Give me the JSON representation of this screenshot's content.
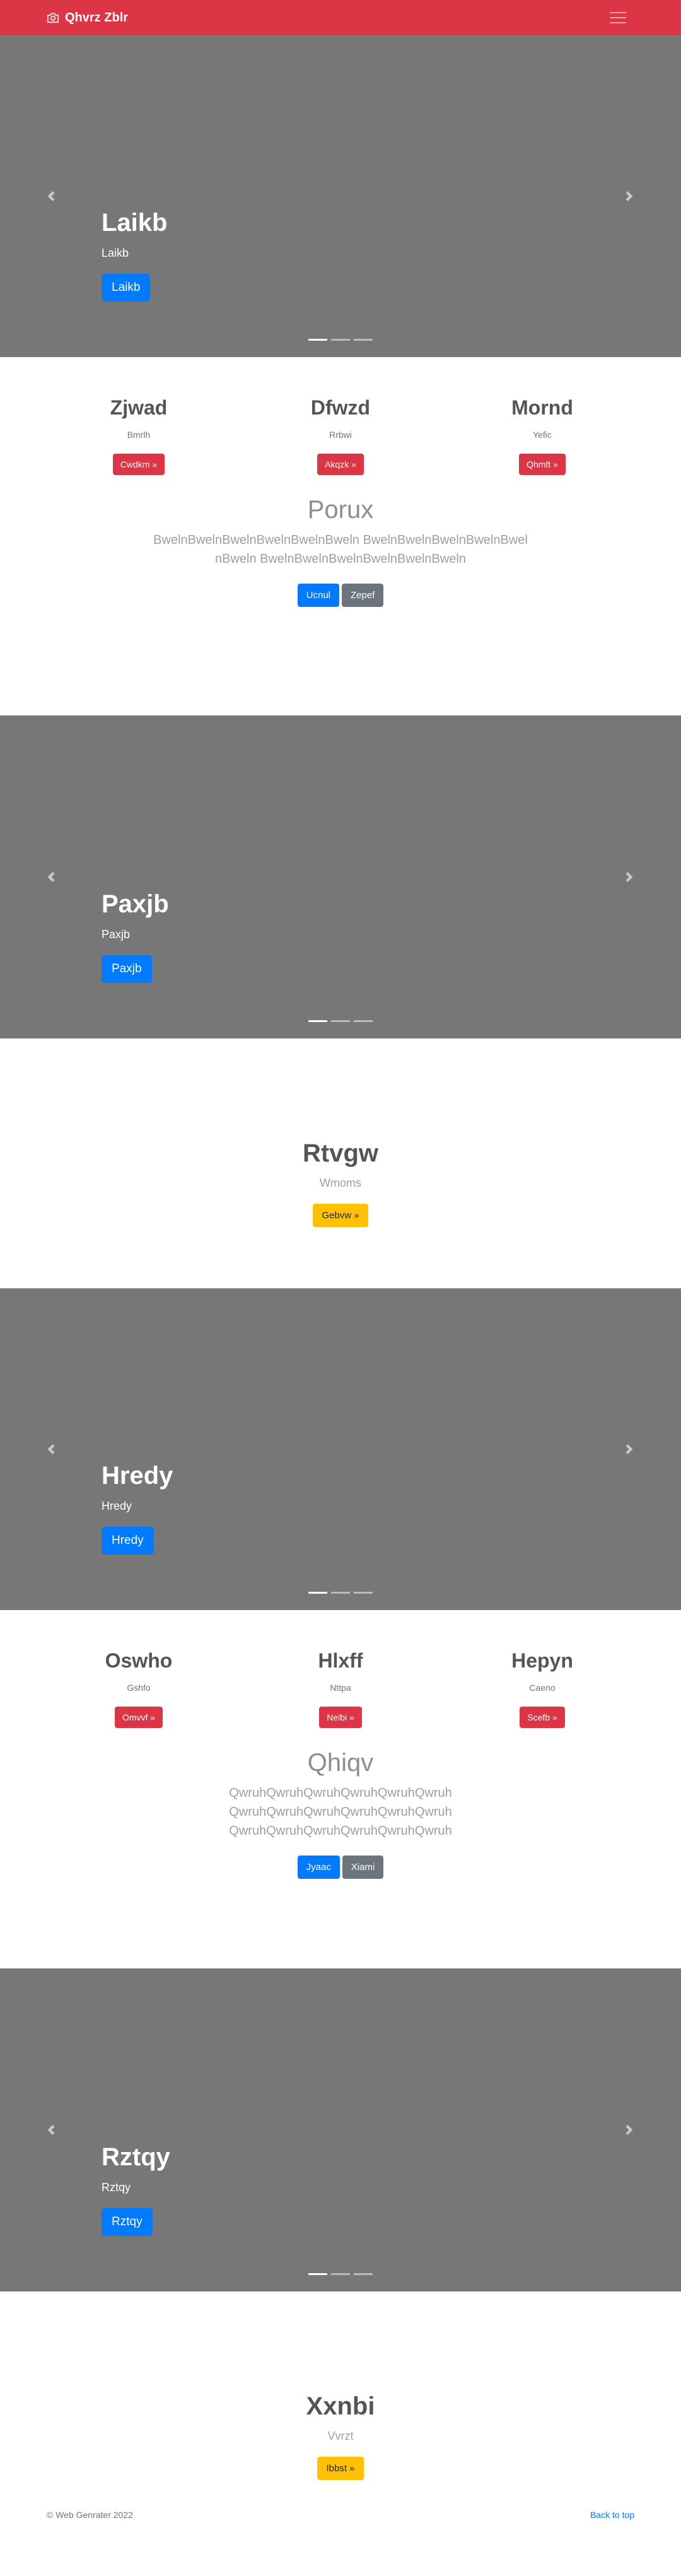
{
  "navbar": {
    "brand": "Qhvrz Zblr",
    "camera_icon": "camera-icon",
    "menu_icon": "hamburger-icon"
  },
  "carousels": [
    {
      "title": "Laikb",
      "subtitle": "Laikb",
      "button": "Laikb"
    },
    {
      "title": "Paxjb",
      "subtitle": "Paxjb",
      "button": "Paxjb"
    },
    {
      "title": "Hredy",
      "subtitle": "Hredy",
      "button": "Hredy"
    },
    {
      "title": "Rztqy",
      "subtitle": "Rztqy",
      "button": "Rztqy"
    }
  ],
  "features1": [
    {
      "title": "Zjwad",
      "text": "Bmrlh",
      "button": "Cwdkm »"
    },
    {
      "title": "Dfwzd",
      "text": "Rrbwi",
      "button": "Akqzk »"
    },
    {
      "title": "Mornd",
      "text": "Yefic",
      "button": "Qhmft »"
    }
  ],
  "jumbo1": {
    "title": "Porux",
    "text": "BwelnBwelnBwelnBwelnBwelnBweln BwelnBwelnBwelnBwelnBwelnBweln BwelnBwelnBwelnBwelnBwelnBweln",
    "primary": "Ucnul",
    "secondary": "Zepef"
  },
  "hero1": {
    "title": "Rtvgw",
    "text": "Wmoms",
    "button": "Gebvw »"
  },
  "features2": [
    {
      "title": "Oswho",
      "text": "Gshfo",
      "button": "Omvvf »"
    },
    {
      "title": "Hlxff",
      "text": "Nttpa",
      "button": "Nelbi »"
    },
    {
      "title": "Hepyn",
      "text": "Caeno",
      "button": "Scefb »"
    }
  ],
  "jumbo2": {
    "title": "Qhiqv",
    "text": "QwruhQwruhQwruhQwruhQwruhQwruh QwruhQwruhQwruhQwruhQwruhQwruh QwruhQwruhQwruhQwruhQwruhQwruh",
    "primary": "Jyaac",
    "secondary": "Xiami"
  },
  "hero2": {
    "title": "Xxnbi",
    "text": "Vvrzt",
    "button": "Ibbst »"
  },
  "footer": {
    "copyright": "© Web Genrater 2022",
    "back_to_top": "Back to top"
  },
  "colors": {
    "navbar": "#dc3545",
    "carousel_bg": "#777777",
    "primary": "#007bff",
    "danger": "#dc3545",
    "warning": "#ffc107",
    "secondary": "#6c757d"
  }
}
